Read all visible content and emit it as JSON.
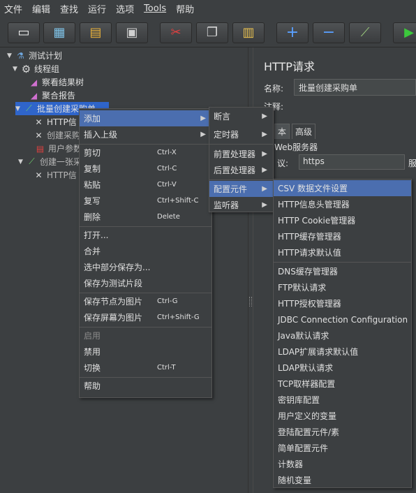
{
  "menubar": [
    "文件",
    "编辑",
    "查找",
    "运行",
    "选项",
    "Tools",
    "帮助"
  ],
  "toolbar": {
    "buttons": [
      {
        "name": "new",
        "icon": "file-icon",
        "glyph": "▭"
      },
      {
        "name": "templates",
        "icon": "templates-icon",
        "glyph": "▦"
      },
      {
        "name": "open",
        "icon": "folder-icon",
        "glyph": "▤"
      },
      {
        "name": "save",
        "icon": "save-icon",
        "glyph": "▣"
      },
      {
        "name": "cut",
        "icon": "scissors-icon",
        "glyph": "✂"
      },
      {
        "name": "copy",
        "icon": "copy-icon",
        "glyph": "❐"
      },
      {
        "name": "paste",
        "icon": "paste-icon",
        "glyph": "▥"
      },
      {
        "name": "expand",
        "icon": "plus-icon",
        "glyph": "+"
      },
      {
        "name": "collapse",
        "icon": "minus-icon",
        "glyph": "−"
      },
      {
        "name": "toggle",
        "icon": "wand-icon",
        "glyph": "⟋"
      },
      {
        "name": "start",
        "icon": "play-icon",
        "glyph": "▶"
      }
    ]
  },
  "tree": {
    "test_plan": "测试计划",
    "thread_group": "线程组",
    "view_results": "察看结果树",
    "aggregate_report": "聚合报告",
    "batch_create": "批量创建采购单",
    "http_1": "HTTP信",
    "create_purchase": "创建采购",
    "user_params": "用户参数",
    "create_one": "创建一张采",
    "http_2": "HTTP信"
  },
  "right_panel": {
    "title": "HTTP请求",
    "name_label": "名称:",
    "name_value": "批量创建采购单",
    "comment_label": "注释:",
    "tab_basic": "本",
    "tab_advanced": "高级",
    "web_server": "Web服务器",
    "protocol_label": "议:",
    "protocol_value": "https",
    "server_partial": "服"
  },
  "context_menu": {
    "items": [
      {
        "label": "添加",
        "shortcut": "",
        "submenu": true,
        "highlight": true
      },
      {
        "label": "插入上级",
        "shortcut": "",
        "submenu": true
      },
      {
        "label": "剪切",
        "shortcut": "Ctrl-X"
      },
      {
        "label": "复制",
        "shortcut": "Ctrl-C"
      },
      {
        "label": "粘贴",
        "shortcut": "Ctrl-V"
      },
      {
        "label": "复写",
        "shortcut": "Ctrl+Shift-C"
      },
      {
        "label": "删除",
        "shortcut": "Delete"
      },
      {
        "label": "打开..."
      },
      {
        "label": "合并"
      },
      {
        "label": "选中部分保存为..."
      },
      {
        "label": "保存为测试片段"
      },
      {
        "label": "保存节点为图片",
        "shortcut": "Ctrl-G"
      },
      {
        "label": "保存屏幕为图片",
        "shortcut": "Ctrl+Shift-G"
      },
      {
        "label": "启用",
        "disabled": true
      },
      {
        "label": "禁用"
      },
      {
        "label": "切换",
        "shortcut": "Ctrl-T"
      },
      {
        "label": "帮助"
      }
    ]
  },
  "add_submenu": {
    "items": [
      {
        "label": "断言"
      },
      {
        "label": "定时器"
      },
      {
        "label": "前置处理器"
      },
      {
        "label": "后置处理器"
      },
      {
        "label": "配置元件",
        "highlight": true
      },
      {
        "label": "监听器"
      }
    ]
  },
  "config_submenu": {
    "items": [
      {
        "label": "CSV 数据文件设置",
        "highlight": true
      },
      {
        "label": "HTTP信息头管理器"
      },
      {
        "label": "HTTP Cookie管理器"
      },
      {
        "label": "HTTP缓存管理器"
      },
      {
        "label": "HTTP请求默认值"
      },
      {
        "label": "DNS缓存管理器"
      },
      {
        "label": "FTP默认请求"
      },
      {
        "label": "HTTP授权管理器"
      },
      {
        "label": "JDBC Connection Configuration"
      },
      {
        "label": "Java默认请求"
      },
      {
        "label": "LDAP扩展请求默认值"
      },
      {
        "label": "LDAP默认请求"
      },
      {
        "label": "TCP取样器配置"
      },
      {
        "label": "密钥库配置"
      },
      {
        "label": "用户定义的变量"
      },
      {
        "label": "登陆配置元件/素"
      },
      {
        "label": "简单配置元件"
      },
      {
        "label": "计数器"
      },
      {
        "label": "随机变量"
      }
    ]
  },
  "colors": {
    "background": "#3c3f41",
    "highlight": "#4b6eaf",
    "selection": "#2f65ca"
  }
}
